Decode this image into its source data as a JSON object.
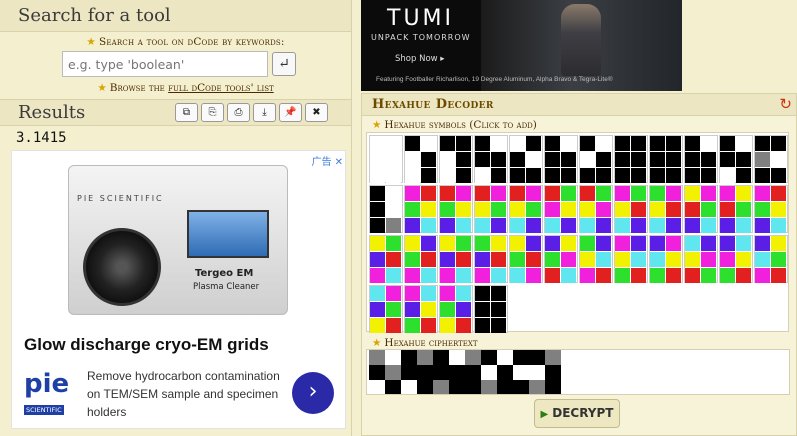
{
  "search": {
    "header": "Search for a tool",
    "keywords_prefix": "Search a tool on dCode by keywords:",
    "placeholder": "e.g. type 'boolean'",
    "enter_icon": "enter-icon",
    "browse_label_a": "Browse the ",
    "browse_label_link": "full dCode tools' list"
  },
  "results": {
    "title": "Results",
    "value": "3.1415",
    "buttons": [
      "copy-icon",
      "duplicate-icon",
      "print-icon",
      "download-icon",
      "pin-icon",
      "close-icon"
    ]
  },
  "ad": {
    "close_text": "广告",
    "machine_brand": "PIE SCIENTIFIC",
    "machine_label": "Tergeo EM",
    "machine_sublabel": "Plasma Cleaner",
    "headline": "Glow discharge cryo-EM grids",
    "logo_text": "pie",
    "logo_sub": "SCIENTIFIC",
    "body": "Remove hydrocarbon contamination on TEM/SEM sample and specimen holders",
    "cta_icon": "chevron-right-icon"
  },
  "banner": {
    "logo": "TUMI",
    "tagline": "UNPACK TOMORROW",
    "shop": "Shop Now ▸",
    "featuring": "Featuring Footballer Richarlison, 19 Degree Aluminum, Alpha Bravo & Tegra-Lite®"
  },
  "decoder": {
    "title": "Hexahue Decoder",
    "reload_icon": "reload-icon",
    "symbols_label": "Hexahue symbols (Click to add)",
    "ciphertext_label": "Hexahue ciphertext",
    "decrypt_label": "DECRYPT"
  },
  "colors": {
    "K": "#000000",
    "W": "#ffffff",
    "G": "#808080",
    "R": "#e32020",
    "Y": "#f2f200",
    "N": "#2ee02e",
    "C": "#60e6ee",
    "B": "#5b1ee6",
    "M": "#f020dc"
  },
  "symbols": [
    [
      "WWWWWW",
      "KWWKWK",
      "KKWKWK",
      "KWKKWK",
      "WKKWKK",
      "KWKKKK",
      "KWWKKK",
      "KKKKKK",
      "KKKKKK",
      "KWKKKK",
      "KWKKWK",
      "KKGWKK"
    ],
    [
      "KWKWKG",
      "MRNYBC",
      "RMNYBC",
      "RMYNCB",
      "RMYNCB",
      "RNMYCB",
      "RNYMCB",
      "MNYRCB",
      "NMYRCB",
      "YMRNBC",
      "MYRNBC",
      "MRNYBC"
    ],
    [
      "YNBRMC",
      "YBNRMC",
      "YNBRMC",
      "NYBRMC",
      "YBNRCM",
      "BYNMRC",
      "NBYCMR",
      "MBYCNR",
      "BMCYNR",
      "CBYMRN",
      "BCMYNR",
      "BYCNMR"
    ],
    [
      "CMBNYR",
      "MCBYNR",
      "MCNBYR",
      "KKKKKK"
    ]
  ],
  "ciphertext": [
    "GWKGWK",
    "KGKKWK",
    "KWKKGK",
    "GKKWKG",
    "WKKWKK",
    "KGWKGK"
  ]
}
